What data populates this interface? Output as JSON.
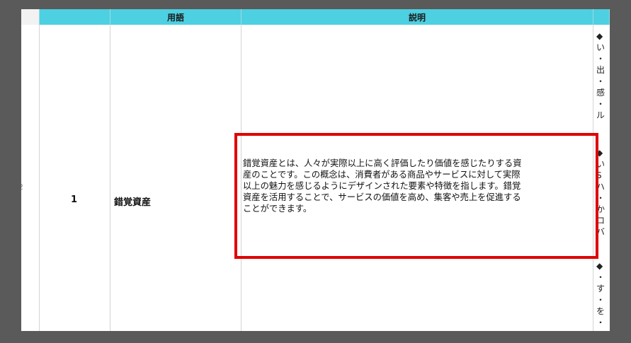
{
  "header": {
    "col0": "",
    "col2": "用語",
    "col3": "説明",
    "col4": ""
  },
  "row": {
    "edge_marker": "2",
    "number": "1",
    "term": "錯覚資産",
    "description_lines": [
      "錯覚資産とは、人々が実際以上に高く評価したり価値を感じたりする資",
      "産のことです。この概念は、消費者がある商品やサービスに対して実際",
      "以上の魅力を感じるようにデザインされた要素や特徴を指します。錯覚",
      "資産を活用することで、サービスの価値を高め、集客や売上を促進する",
      "ことができます。"
    ]
  },
  "side_column_fragments": {
    "block1": [
      "◆",
      "い",
      "・",
      "出",
      "・",
      "感",
      "・",
      "ル"
    ],
    "block2": [
      "◆",
      "い",
      "S",
      "ハ",
      "・",
      "か",
      "ロ",
      "バ"
    ],
    "block3": [
      "◆",
      "・",
      "す",
      "・",
      "を",
      "・"
    ]
  },
  "colors": {
    "header_bg": "#4dd0e1",
    "highlight_border": "#e00000",
    "background": "#5a5a5a"
  }
}
